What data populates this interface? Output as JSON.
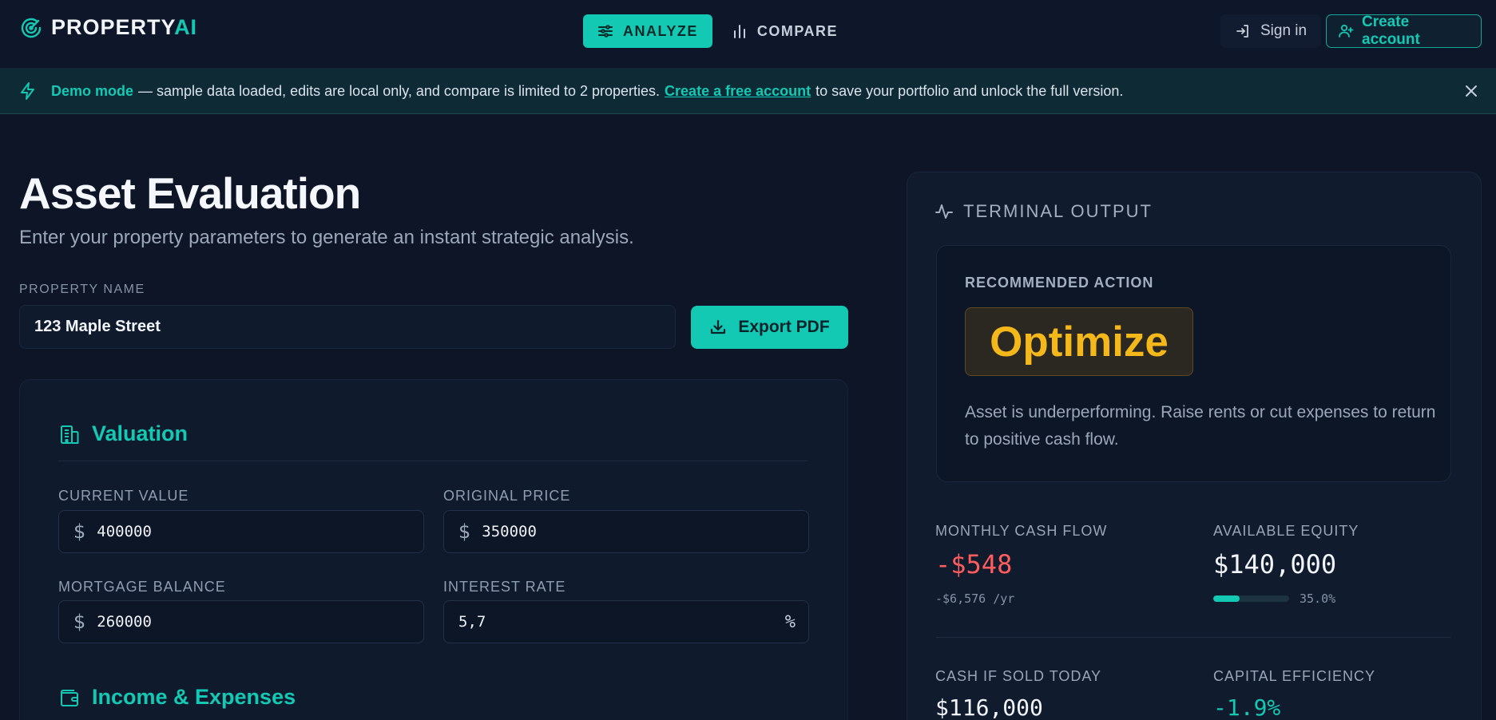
{
  "header": {
    "logo_main": "PROPERTY",
    "logo_accent": "AI",
    "nav": [
      {
        "label": "ANALYZE",
        "icon": "sliders-icon",
        "active": true
      },
      {
        "label": "COMPARE",
        "icon": "bar-chart-icon",
        "active": false
      }
    ],
    "signin_label": "Sign in",
    "create_label": "Create account"
  },
  "banner": {
    "demo_label": "Demo mode",
    "text_before": "— sample data loaded, edits are local only, and compare is limited to 2 properties.",
    "link_label": "Create a free account",
    "text_after": "to save your portfolio and unlock the full version."
  },
  "main": {
    "title": "Asset Evaluation",
    "subtitle": "Enter your property parameters to generate an instant strategic analysis.",
    "property_name_label": "PROPERTY NAME",
    "property_name_value": "123 Maple Street",
    "export_label": "Export PDF",
    "valuation": {
      "title": "Valuation",
      "current_value": {
        "label": "CURRENT VALUE",
        "prefix": "$",
        "value": "400000"
      },
      "original_price": {
        "label": "ORIGINAL PRICE",
        "prefix": "$",
        "value": "350000"
      },
      "mortgage_balance": {
        "label": "MORTGAGE BALANCE",
        "prefix": "$",
        "value": "260000"
      },
      "interest_rate": {
        "label": "INTEREST RATE",
        "value": "5,7",
        "suffix": "%"
      }
    },
    "income": {
      "title": "Income & Expenses"
    }
  },
  "terminal": {
    "title": "TERMINAL OUTPUT",
    "rec_label": "RECOMMENDED ACTION",
    "rec_value": "Optimize",
    "rec_desc": "Asset is underperforming. Raise rents or cut expenses to return to positive cash flow.",
    "monthly_cash_flow": {
      "label": "MONTHLY CASH FLOW",
      "value": "-$548",
      "sub": "-$6,576 /yr"
    },
    "available_equity": {
      "label": "AVAILABLE EQUITY",
      "value": "$140,000",
      "pct_label": "35.0%",
      "fraction": 0.35
    },
    "cash_if_sold": {
      "label": "CASH IF SOLD TODAY",
      "value": "$116,000"
    },
    "capital_efficiency": {
      "label": "CAPITAL EFFICIENCY",
      "value": "-1.9%"
    }
  },
  "colors": {
    "accent": "#14c9b4",
    "negative": "#ff5d5d",
    "warning": "#f5b81a",
    "background": "#0d1526"
  }
}
